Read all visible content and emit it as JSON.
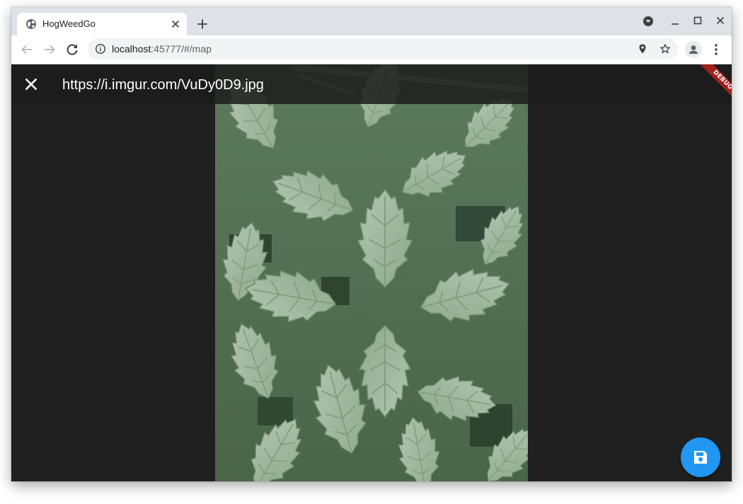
{
  "browser": {
    "tab": {
      "title": "HogWeedGo",
      "favicon_icon": "globe-icon",
      "close_icon": "close-icon"
    },
    "new_tab_icon": "plus-icon",
    "window_controls": [
      "tab-search-icon",
      "minimize-icon",
      "maximize-icon",
      "close-icon"
    ],
    "address_bar": {
      "host": "localhost",
      "path": ":45777/#/map",
      "info_icon": "info-icon"
    },
    "toolbar_icons": [
      "back-arrow-icon",
      "forward-arrow-icon",
      "reload-icon",
      "location-pin-icon",
      "star-icon",
      "profile-icon",
      "more-vert-icon"
    ]
  },
  "app": {
    "appbar": {
      "title": "https://i.imgur.com/VuDy0D9.jpg",
      "close_icon": "close-icon"
    },
    "debug_banner": "DEBUG",
    "image": {
      "subject": "nettle plant leaves"
    },
    "fab": {
      "icon": "save-icon",
      "color": "#2196f3"
    },
    "colors": {
      "background": "#202020",
      "appbar": "#1c1c1c",
      "debug": "#a0201c"
    }
  }
}
